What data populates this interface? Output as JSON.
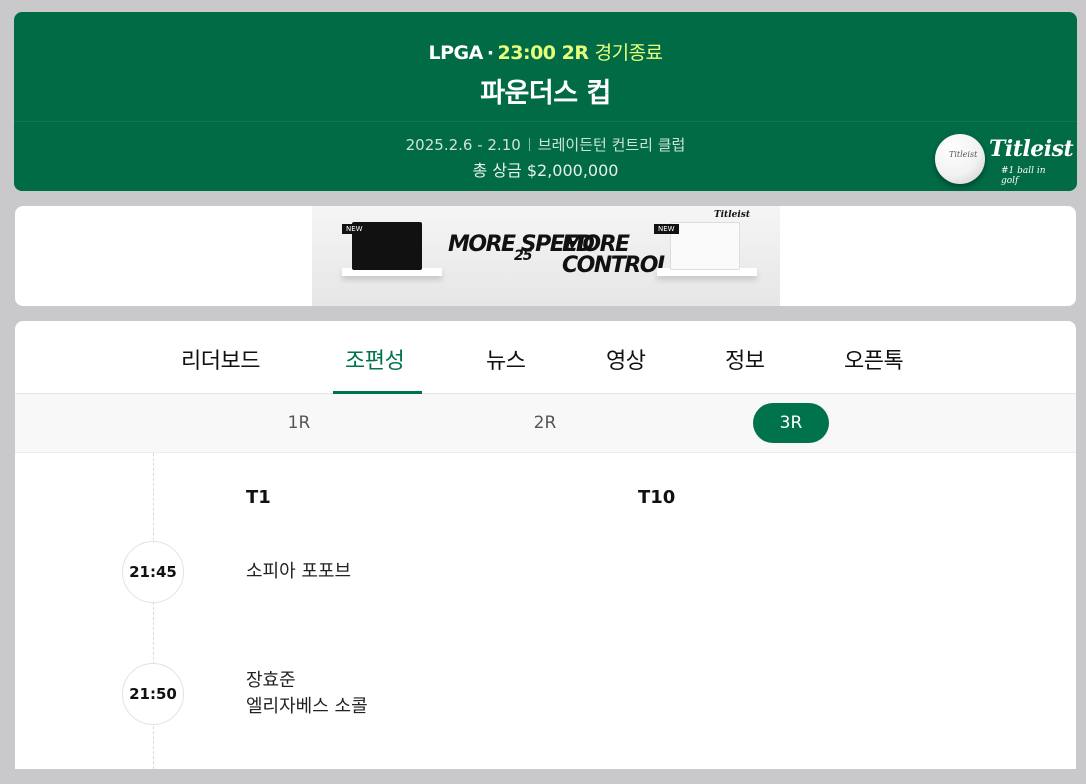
{
  "header": {
    "league": "LPGA",
    "time_round": "23:00 2R",
    "status": "경기종료",
    "title": "파운더스 컵",
    "dates": "2025.2.6 - 2.10",
    "venue": "브레이든턴 컨트리 클럽",
    "prize": "총 상금 $2,000,000",
    "sponsor": {
      "brand": "Titleist",
      "tagline": "#1 ball in golf",
      "ball_mark": "Titleist"
    }
  },
  "ad": {
    "left_text": "MORE SPEED",
    "center_text": "25",
    "right_text": "MORE CONTROL",
    "new_label": "NEW",
    "brand": "Titleist"
  },
  "tabs": [
    {
      "label": "리더보드",
      "active": false
    },
    {
      "label": "조편성",
      "active": true
    },
    {
      "label": "뉴스",
      "active": false
    },
    {
      "label": "영상",
      "active": false
    },
    {
      "label": "정보",
      "active": false
    },
    {
      "label": "오픈톡",
      "active": false
    }
  ],
  "rounds": [
    {
      "label": "1R",
      "active": false
    },
    {
      "label": "2R",
      "active": false
    },
    {
      "label": "3R",
      "active": true
    }
  ],
  "schedule": {
    "tee_columns": [
      "T1",
      "T10"
    ],
    "groups": [
      {
        "time": "21:45",
        "t1_players": [
          "소피아 포포브"
        ]
      },
      {
        "time": "21:50",
        "t1_players": [
          "장효준",
          "엘리자베스 소콜"
        ]
      }
    ]
  },
  "colors": {
    "header_bg": "#006b45",
    "accent_green": "#00734c",
    "highlight_yellow": "#e7ff7a"
  }
}
